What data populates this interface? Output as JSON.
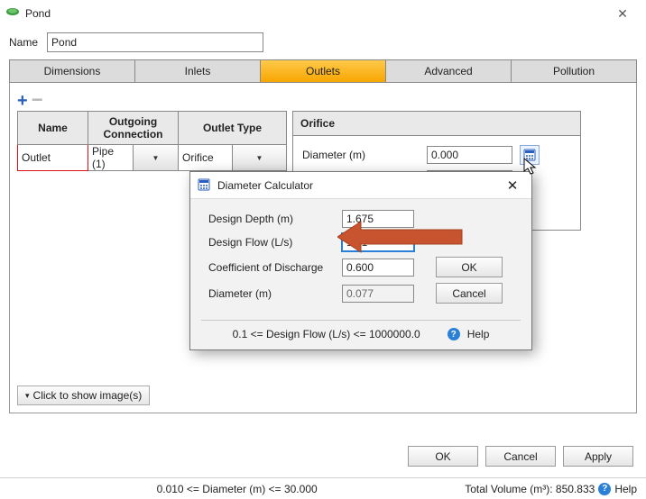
{
  "window": {
    "title": "Pond"
  },
  "name_label": "Name",
  "name_value": "Pond",
  "tabs": [
    "Dimensions",
    "Inlets",
    "Outlets",
    "Advanced",
    "Pollution"
  ],
  "active_tab": "Outlets",
  "grid": {
    "headers": [
      "Name",
      "Outgoing Connection",
      "Outlet Type"
    ],
    "row": {
      "name": "Outlet",
      "connection": "Pipe (1)",
      "type": "Orifice"
    }
  },
  "orifice": {
    "title": "Orifice",
    "label": "Diameter (m)",
    "value": "0.000"
  },
  "show_images": "Click to show image(s)",
  "buttons": {
    "ok": "OK",
    "cancel": "Cancel",
    "apply": "Apply"
  },
  "status_left": "0.010 <= Diameter (m) <= 30.000",
  "status_right": "Total Volume (m³): 850.833",
  "status_help": "Help",
  "modal": {
    "title": "Diameter Calculator",
    "f1_label": "Design Depth (m)",
    "f1_val": "1.675",
    "f2_label": "Design Flow (L/s)",
    "f2_val": "16.1",
    "f3_label": "Coefficient of Discharge",
    "f3_val": "0.600",
    "f4_label": "Diameter (m)",
    "f4_val": "0.077",
    "ok": "OK",
    "cancel": "Cancel",
    "foot": "0.1 <= Design Flow (L/s) <= 1000000.0",
    "help": "Help"
  }
}
